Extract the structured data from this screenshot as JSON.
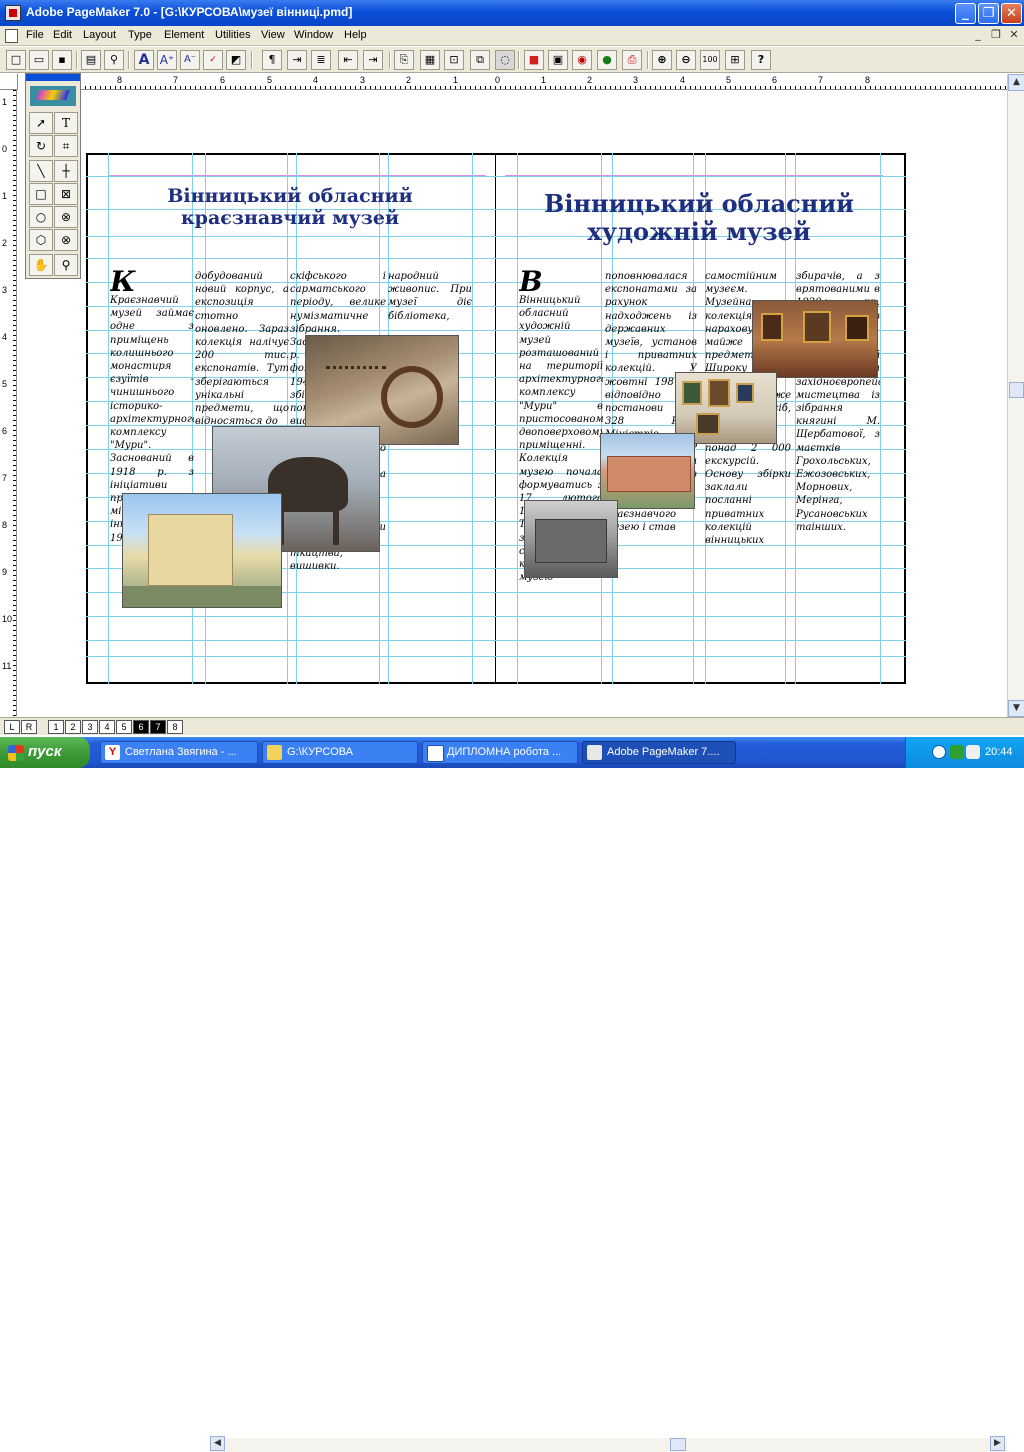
{
  "window": {
    "title": "Adobe PageMaker 7.0 - [G:\\КУРСОВА\\музеї вінниці.pmd]",
    "minimize": "_",
    "maximize": "❐",
    "close": "✕"
  },
  "menu": [
    "File",
    "Edit",
    "Layout",
    "Type",
    "Element",
    "Utilities",
    "View",
    "Window",
    "Help"
  ],
  "doc_controls": [
    "_",
    "❐",
    "✕"
  ],
  "toolbar": {
    "buttons": [
      "new-icon",
      "open-icon",
      "save-icon",
      "print-icon",
      "find-icon",
      "text-a-icon",
      "font-size-up-icon",
      "font-size-down-icon",
      "spell-icon",
      "define-styles-icon",
      "paragraph-icon",
      "tabs-icon",
      "indent-icon",
      "bullets-icon",
      "numbering-icon",
      "copy-icon",
      "paste-icon",
      "place-icon",
      "link-icon",
      "fill-icon",
      "color-icon",
      "view-icon",
      "web-icon",
      "pdf-icon",
      "zoom-in-icon",
      "zoom-out-icon",
      "actual-size-icon",
      "fit-icon",
      "help-icon"
    ],
    "zoom_label": "100",
    "help_label": "?"
  },
  "ruler": {
    "h_numbers": [
      "8",
      "7",
      "6",
      "5",
      "4",
      "3",
      "2",
      "1",
      "0",
      "1",
      "2",
      "3",
      "4",
      "5",
      "6",
      "7",
      "8"
    ],
    "v_numbers": [
      "1",
      "0",
      "1",
      "2",
      "3",
      "4",
      "5",
      "6",
      "7",
      "8",
      "9",
      "10",
      "11"
    ]
  },
  "toolbox": {
    "tools": [
      "pointer-tool",
      "text-tool",
      "rotate-tool",
      "crop-tool",
      "line-tool",
      "constrained-line-tool",
      "rectangle-tool",
      "rectangle-frame-tool",
      "ellipse-tool",
      "ellipse-frame-tool",
      "polygon-tool",
      "polygon-frame-tool",
      "hand-tool",
      "zoom-tool"
    ],
    "text_tool_glyph": "T"
  },
  "left_page": {
    "heading": "Вінницький обласний краєзнавчий музей",
    "col1": "Краєзнавчий музей займає одне з приміщень колишнього монастиря єзуїтів - чинишнього історико-архітектурного комплексу \"Мури\". Заснований в 1918 р. з ініціативи представників місцевої інтелігенції. У 1970 р. був",
    "col2": "добудований новий корпус, а експозиція стотно оновлено. Зараз колекція налічує 200 тис. експонатів. Тут зберігаються унікальні предмети, що відносяться до",
    "col3": "скіфського і сарматського періоду, велике нумізматичне зібрання. Засновано у 1920 р. Із довоєнний фонд знищено у 1943 р. Сучасна збірка містить понад 10,5 тис. видань кінця XVIII - поч. XXI ст., переважно українською, російською та польською мовами. етнографічна колекція: вироби гончарства, ткацтва, вишивки.",
    "col4": "народний живопис. При музеї діє бібліотека,"
  },
  "right_page": {
    "heading": "Вінницький обласний художній музей",
    "col1": "Вінницький обласний художній музей розташований на території архітектурного комплексу \"Мури\" в пристосованому двоповерховому приміщенні. Колекція музею почала формуватись з 17 лютого 1919 р. Тривалий час знаходилася у складі краєзнавчого музею",
    "col2": "поповнювалася експонатами за рахунок надходжень із державних музеїв, установ і приватних колекцій. У жовтні 1987 р. відповідно до постанови № 328 Ради Міністрів Української РСР художній відділ відокремився із структури обласного краєзнавчого музею і став",
    "col3": "самостійним музеєм. Музейна колекція нараховує майже 10 000 предметів. Широку музейну відвідує майже 150000 осіб, для проводиться понад 2 000 екскурсій. Основу збірки заклали посланні приватних колекцій вінницьких",
    "col4": "збирачів, а з врятованими в 1920-х рр. творами з розорених поміщицьких садиб. До неї увійшли твори західноєвропейського мистецтва із зібрання княгині М. Щербатової, з маєтків Грохольських, Ежозовських, Морнових, Мерінга, Русановських таінших."
  },
  "page_tabs": [
    "L",
    "R",
    "1",
    "2",
    "3",
    "4",
    "5",
    "6",
    "7",
    "8"
  ],
  "active_page": "7",
  "taskbar": {
    "start": "пуск",
    "tasks": [
      {
        "label": "Светлана Звягина - ...",
        "icon": "yandex-icon"
      },
      {
        "label": "G:\\КУРСОВА",
        "icon": "folder-icon"
      },
      {
        "label": "ДИПЛОМНА робота ...",
        "icon": "word-icon"
      },
      {
        "label": "Adobe PageMaker 7....",
        "icon": "pagemaker-icon"
      }
    ],
    "lang": "EN",
    "time": "20:44"
  }
}
